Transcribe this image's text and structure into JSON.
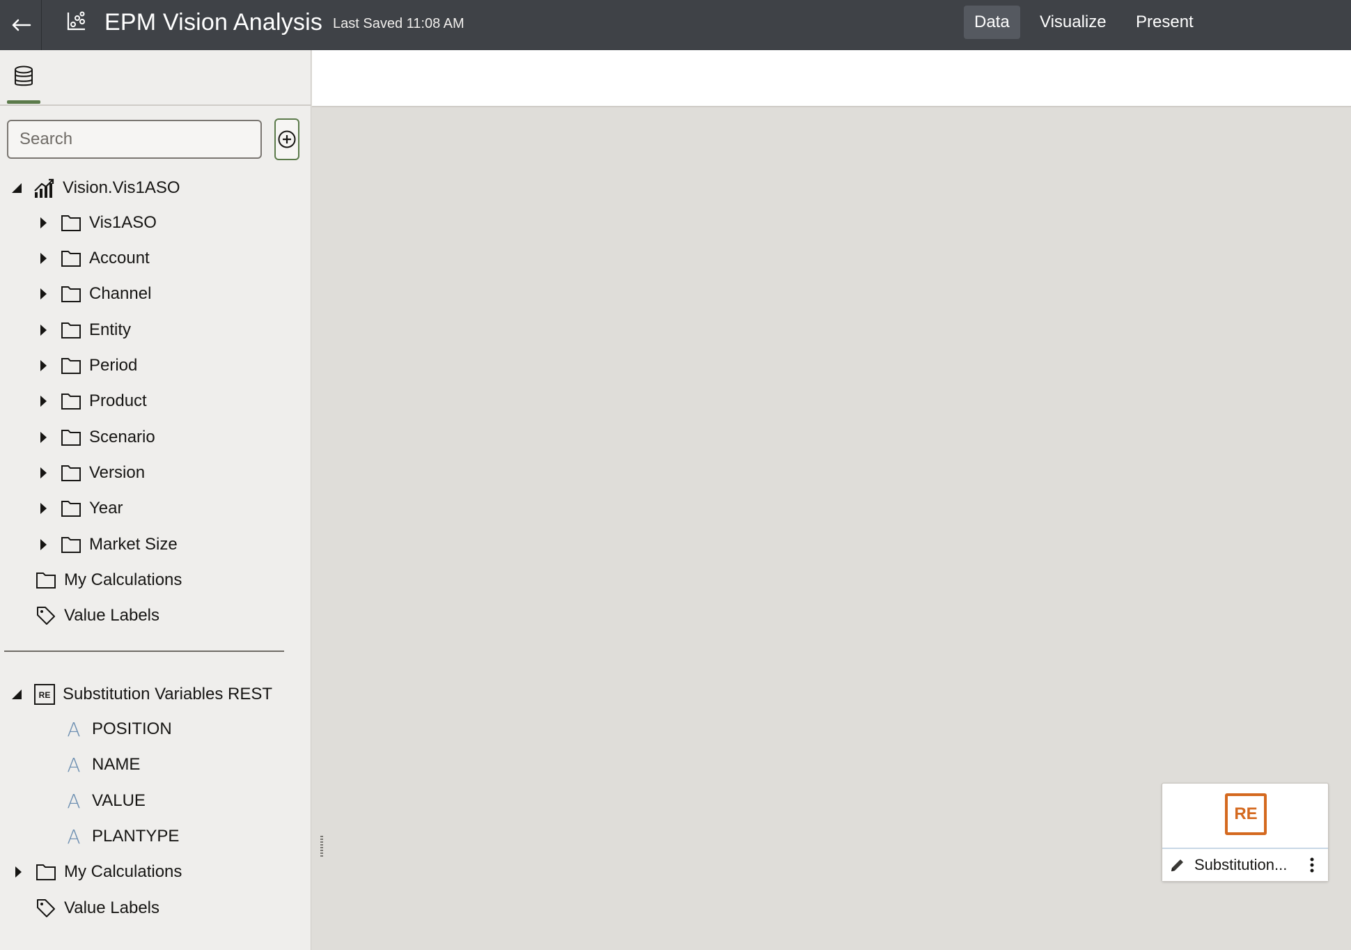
{
  "header": {
    "back_icon": "arrow-left-icon",
    "app_icon": "analytics-icon",
    "title": "EPM Vision Analysis",
    "last_saved": "Last Saved 11:08 AM",
    "tabs": [
      {
        "label": "Data",
        "active": true
      },
      {
        "label": "Visualize",
        "active": false
      },
      {
        "label": "Present",
        "active": false
      }
    ]
  },
  "colors": {
    "header_bg": "#3f4247",
    "accent_green": "#5b7a4a",
    "re_orange": "#d4691f",
    "attribute_blue": "#6a8db0"
  },
  "sidebar": {
    "tab_icon": "database-icon",
    "search_placeholder": "Search",
    "add_icon": "add-circle-icon",
    "sources": [
      {
        "name": "Vision.Vis1ASO",
        "icon": "cube-chart-icon",
        "expanded": true,
        "children": [
          {
            "label": "Vis1ASO",
            "icon": "folder-icon",
            "expandable": true
          },
          {
            "label": "Account",
            "icon": "folder-icon",
            "expandable": true
          },
          {
            "label": "Channel",
            "icon": "folder-icon",
            "expandable": true
          },
          {
            "label": "Entity",
            "icon": "folder-icon",
            "expandable": true
          },
          {
            "label": "Period",
            "icon": "folder-icon",
            "expandable": true
          },
          {
            "label": "Product",
            "icon": "folder-icon",
            "expandable": true
          },
          {
            "label": "Scenario",
            "icon": "folder-icon",
            "expandable": true
          },
          {
            "label": "Version",
            "icon": "folder-icon",
            "expandable": true
          },
          {
            "label": "Year",
            "icon": "folder-icon",
            "expandable": true
          },
          {
            "label": "Market Size",
            "icon": "folder-icon",
            "expandable": true
          }
        ],
        "extras": [
          {
            "label": "My Calculations",
            "icon": "folder-icon"
          },
          {
            "label": "Value Labels",
            "icon": "tag-icon"
          }
        ]
      },
      {
        "name": "Substitution Variables REST",
        "icon": "re-source-icon",
        "icon_text": "RE",
        "expanded": true,
        "children": [
          {
            "label": "POSITION",
            "icon": "attribute-icon",
            "glyph": "A"
          },
          {
            "label": "NAME",
            "icon": "attribute-icon",
            "glyph": "A"
          },
          {
            "label": "VALUE",
            "icon": "attribute-icon",
            "glyph": "A"
          },
          {
            "label": "PLANTYPE",
            "icon": "attribute-icon",
            "glyph": "A"
          }
        ],
        "extras": [
          {
            "label": "My Calculations",
            "icon": "folder-icon",
            "expandable": true
          },
          {
            "label": "Value Labels",
            "icon": "tag-icon"
          }
        ]
      }
    ]
  },
  "source_card": {
    "icon_text": "RE",
    "name": "Substitution...",
    "edit_icon": "pencil-icon",
    "menu_icon": "kebab-menu-icon"
  }
}
